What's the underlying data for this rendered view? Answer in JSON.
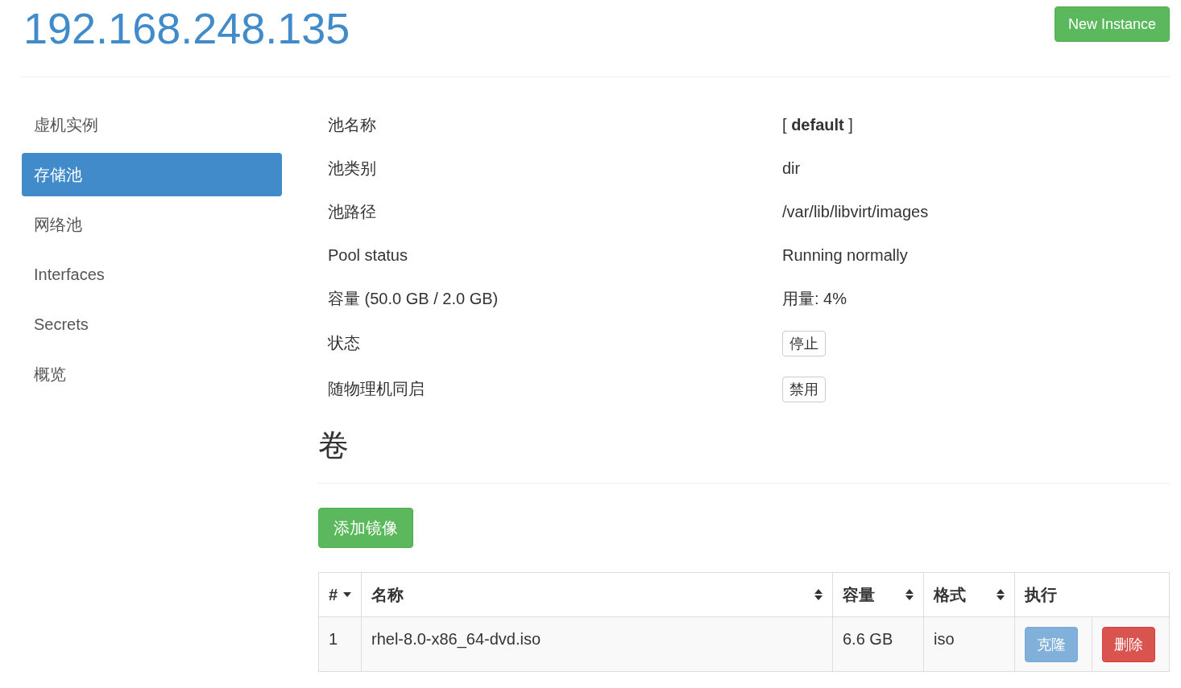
{
  "header": {
    "title": "192.168.248.135",
    "new_button": "New Instance"
  },
  "sidebar": {
    "items": [
      {
        "label": "虚机实例",
        "selected": false
      },
      {
        "label": "存储池",
        "selected": true
      },
      {
        "label": "网络池",
        "selected": false
      },
      {
        "label": "Interfaces",
        "selected": false
      },
      {
        "label": "Secrets",
        "selected": false
      },
      {
        "label": "概览",
        "selected": false
      }
    ]
  },
  "properties": [
    {
      "kind": "text",
      "label": "池名称",
      "value": "[ **default** ]"
    },
    {
      "kind": "text",
      "label": "池类别",
      "value": "dir"
    },
    {
      "kind": "text",
      "label": "池路径",
      "value": "/var/lib/libvirt/images"
    },
    {
      "kind": "text",
      "label": "Pool status",
      "value": "Running normally"
    },
    {
      "kind": "text",
      "label": "容量 (50.0 GB / 2.0 GB)",
      "value": "用量: 4%"
    },
    {
      "kind": "button",
      "label": "状态",
      "value": "停止"
    },
    {
      "kind": "button",
      "label": "随物理机同启",
      "value": "禁用"
    }
  ],
  "volumes": {
    "title": "卷",
    "add_button": "添加镜像",
    "table": {
      "columns": [
        {
          "label": "#",
          "kind": "sorted"
        },
        {
          "label": "名称",
          "kind": "sortable"
        },
        {
          "label": "容量",
          "kind": "sortable"
        },
        {
          "label": "格式",
          "kind": "sortable"
        },
        {
          "label": "执行",
          "kind": "plain"
        }
      ],
      "rows": [
        {
          "cells": [
            "1",
            "rhel-8.0-x86_64-dvd.iso",
            "6.6 GB",
            "iso"
          ],
          "actions": [
            {
              "kind": "primary",
              "label": "克隆",
              "disabled": true
            },
            {
              "kind": "danger",
              "label": "删除",
              "disabled": false
            }
          ]
        }
      ]
    }
  }
}
